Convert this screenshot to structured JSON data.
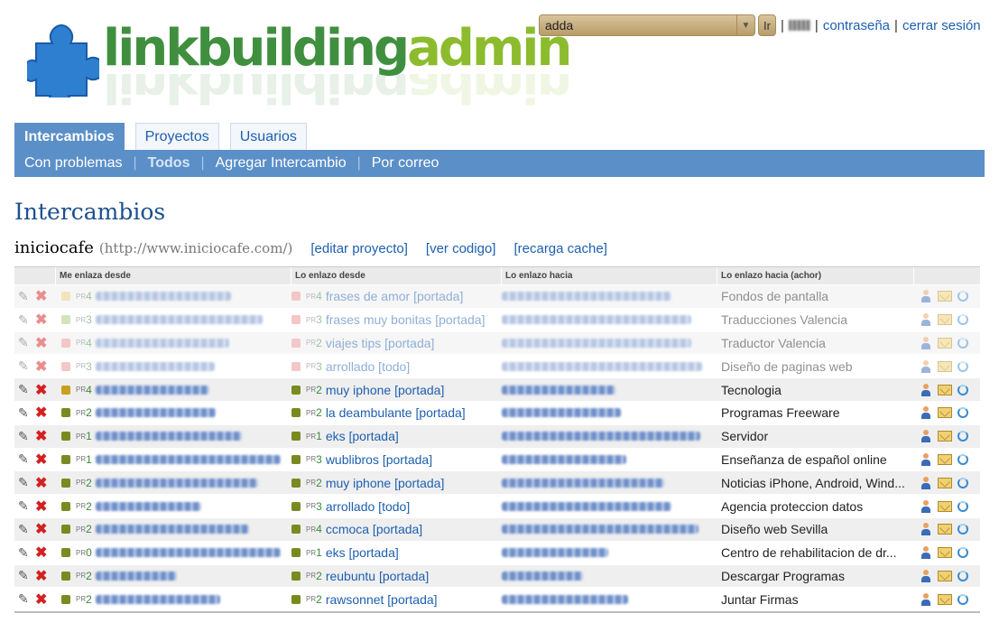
{
  "app": {
    "logo_part1": "linkbuilding",
    "logo_part2": "admin",
    "colors": {
      "nav": "#5b8fc7",
      "link": "#1d5fb0",
      "logo_dark": "#3f8f3f",
      "logo_light": "#8cbc2e"
    }
  },
  "topbar": {
    "project_select": "adda",
    "go_label": "Ir",
    "password_label": "contraseña",
    "logout_label": "cerrar sesión"
  },
  "tabs": [
    "Intercambios",
    "Proyectos",
    "Usuarios"
  ],
  "subnav": [
    "Con problemas",
    "Todos",
    "Agregar Intercambio",
    "Por correo"
  ],
  "page_title": "Intercambios",
  "project": {
    "name": "iniciocafe",
    "url": "(http://www.iniciocafe.com/)",
    "edit_label": "[editar proyecto]",
    "code_label": "[ver codigo]",
    "cache_label": "[recarga cache]"
  },
  "table": {
    "headers": [
      "Me enlaza desde",
      "Lo enlazo desde",
      "Lo enlazo hacia",
      "Lo enlazo hacia (achor)"
    ],
    "pr_prefix": "PR",
    "rows": [
      {
        "faded": true,
        "sq1": "#e8c878",
        "pr1": "4",
        "sq2": "#e89090",
        "pr2": "4",
        "link": "frases de amor [portada]",
        "anchor": "Fondos de pantalla"
      },
      {
        "faded": true,
        "sq1": "#a8c878",
        "pr1": "3",
        "sq2": "#e89090",
        "pr2": "3",
        "link": "frases muy bonitas [portada]",
        "anchor": "Traducciones Valencia"
      },
      {
        "faded": true,
        "sq1": "#e89090",
        "pr1": "4",
        "sq2": "#e89090",
        "pr2": "2",
        "link": "viajes tips [portada]",
        "anchor": "Traductor Valencia"
      },
      {
        "faded": true,
        "sq1": "#e89090",
        "pr1": "3",
        "sq2": "#e89090",
        "pr2": "3",
        "link": "arrollado [todo]",
        "anchor": "Diseño de paginas web"
      },
      {
        "faded": false,
        "sq1": "#c8a020",
        "pr1": "4",
        "sq2": "#7a8a20",
        "pr2": "2",
        "link": "muy iphone [portada]",
        "anchor": "Tecnologia"
      },
      {
        "faded": false,
        "sq1": "#7a8a20",
        "pr1": "2",
        "sq2": "#7a8a20",
        "pr2": "2",
        "link": "la deambulante [portada]",
        "anchor": "Programas Freeware"
      },
      {
        "faded": false,
        "sq1": "#7a8a20",
        "pr1": "1",
        "sq2": "#7a8a20",
        "pr2": "1",
        "link": "eks [portada]",
        "anchor": "Servidor"
      },
      {
        "faded": false,
        "sq1": "#7a8a20",
        "pr1": "1",
        "sq2": "#7a8a20",
        "pr2": "3",
        "link": "wublibros [portada]",
        "anchor": "Enseñanza de español online"
      },
      {
        "faded": false,
        "sq1": "#7a8a20",
        "pr1": "2",
        "sq2": "#7a8a20",
        "pr2": "2",
        "link": "muy iphone [portada]",
        "anchor": "Noticias iPhone, Android, Wind..."
      },
      {
        "faded": false,
        "sq1": "#7a8a20",
        "pr1": "2",
        "sq2": "#7a8a20",
        "pr2": "3",
        "link": "arrollado [todo]",
        "anchor": "Agencia proteccion datos"
      },
      {
        "faded": false,
        "sq1": "#7a8a20",
        "pr1": "2",
        "sq2": "#7a8a20",
        "pr2": "4",
        "link": "ccmoca [portada]",
        "anchor": "Diseño web Sevilla"
      },
      {
        "faded": false,
        "sq1": "#7a8a20",
        "pr1": "0",
        "sq2": "#7a8a20",
        "pr2": "1",
        "link": "eks [portada]",
        "anchor": "Centro de rehabilitacion de dr..."
      },
      {
        "faded": false,
        "sq1": "#7a8a20",
        "pr1": "2",
        "sq2": "#7a8a20",
        "pr2": "2",
        "link": "reubuntu [portada]",
        "anchor": "Descargar Programas"
      },
      {
        "faded": false,
        "sq1": "#7a8a20",
        "pr1": "2",
        "sq2": "#7a8a20",
        "pr2": "2",
        "link": "rawsonnet [portada]",
        "anchor": "Juntar Firmas"
      }
    ]
  }
}
